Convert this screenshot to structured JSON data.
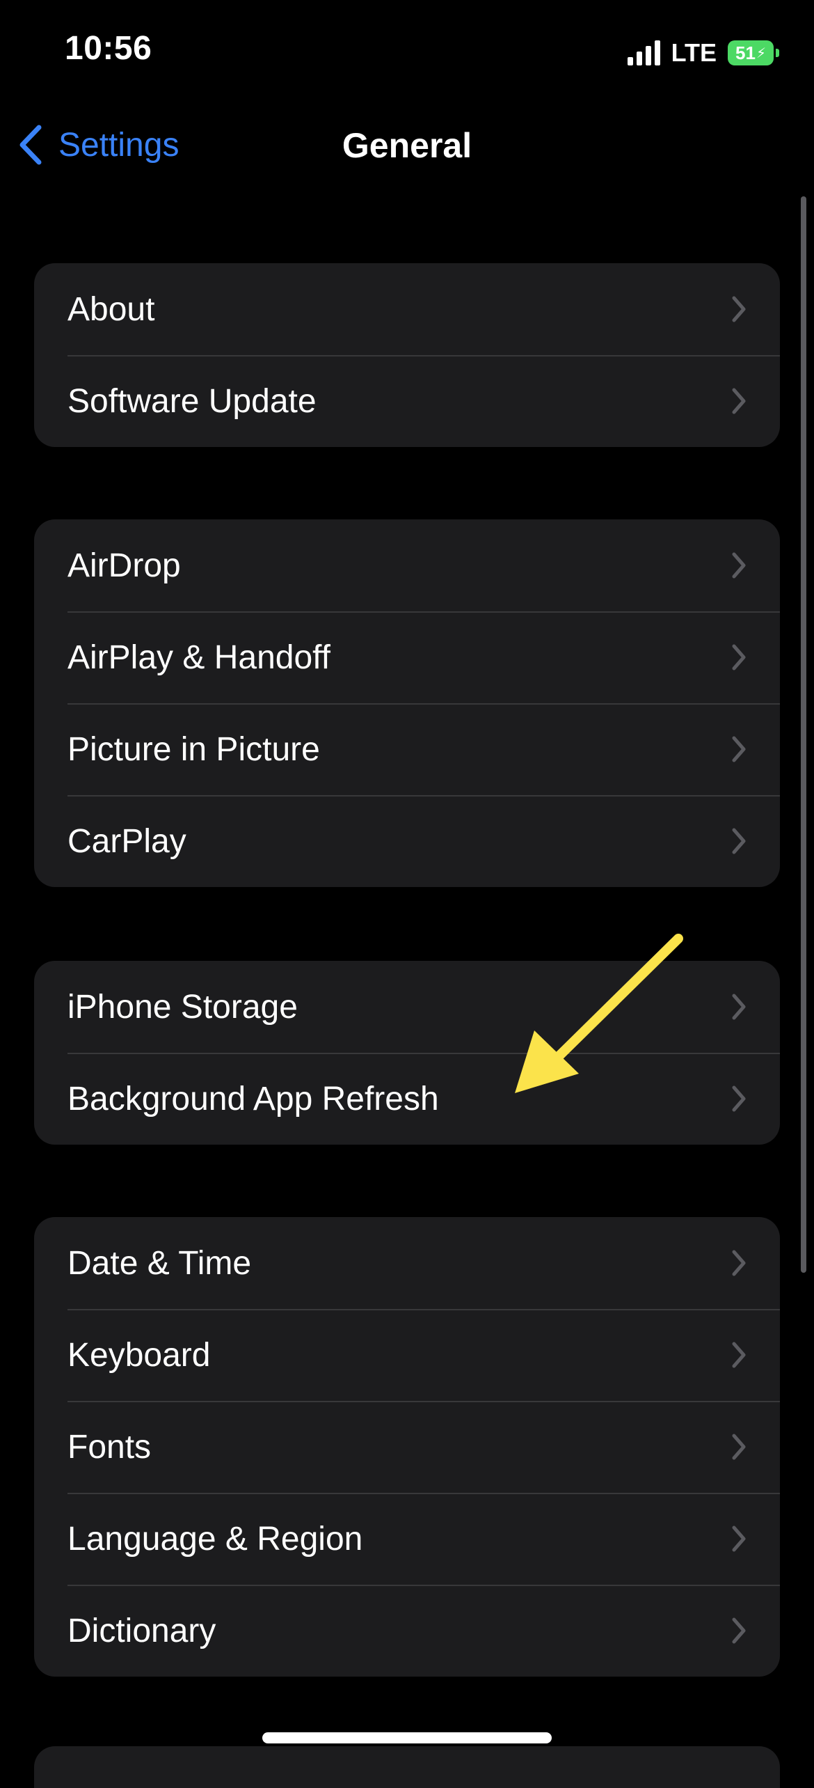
{
  "status_bar": {
    "time": "10:56",
    "network": "LTE",
    "battery": "51",
    "battery_color": "#4cd964"
  },
  "nav": {
    "back_label": "Settings",
    "title": "General",
    "accent_color": "#3a82f7"
  },
  "groups": [
    {
      "items": [
        {
          "label": "About"
        },
        {
          "label": "Software Update"
        }
      ]
    },
    {
      "items": [
        {
          "label": "AirDrop"
        },
        {
          "label": "AirPlay & Handoff"
        },
        {
          "label": "Picture in Picture"
        },
        {
          "label": "CarPlay"
        }
      ]
    },
    {
      "items": [
        {
          "label": "iPhone Storage"
        },
        {
          "label": "Background App Refresh"
        }
      ]
    },
    {
      "items": [
        {
          "label": "Date & Time"
        },
        {
          "label": "Keyboard"
        },
        {
          "label": "Fonts"
        },
        {
          "label": "Language & Region"
        },
        {
          "label": "Dictionary"
        }
      ]
    }
  ],
  "icons": {
    "back": "chevron-left-icon",
    "row": "chevron-right-icon",
    "annotation": "arrow-annotation-icon"
  }
}
